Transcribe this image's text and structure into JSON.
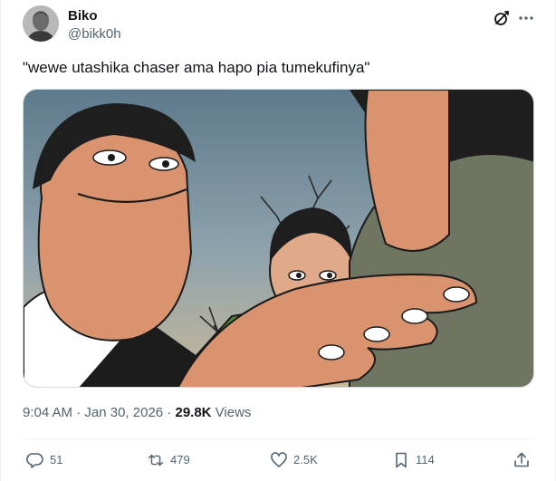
{
  "author": {
    "display_name": "Biko",
    "handle": "@bikk0h"
  },
  "icons": {
    "grok": "grok-icon",
    "more": "more-icon",
    "reply": "reply-icon",
    "repost": "repost-icon",
    "like": "heart-icon",
    "bookmark": "bookmark-icon",
    "share": "share-icon"
  },
  "tweet": {
    "text": "\"wewe utashika chaser ama hapo pia tumekufinya\""
  },
  "meta": {
    "time": "9:04 AM",
    "separator1": " · ",
    "date": "Jan 30, 2026",
    "separator2": " · ",
    "views_count": "29.8K",
    "views_label": " Views"
  },
  "actions": {
    "replies": "51",
    "reposts": "479",
    "likes": "2.5K",
    "bookmarks": "114"
  },
  "colors": {
    "text_primary": "#0f1419",
    "text_secondary": "#536471",
    "divider": "#eff3f4"
  }
}
